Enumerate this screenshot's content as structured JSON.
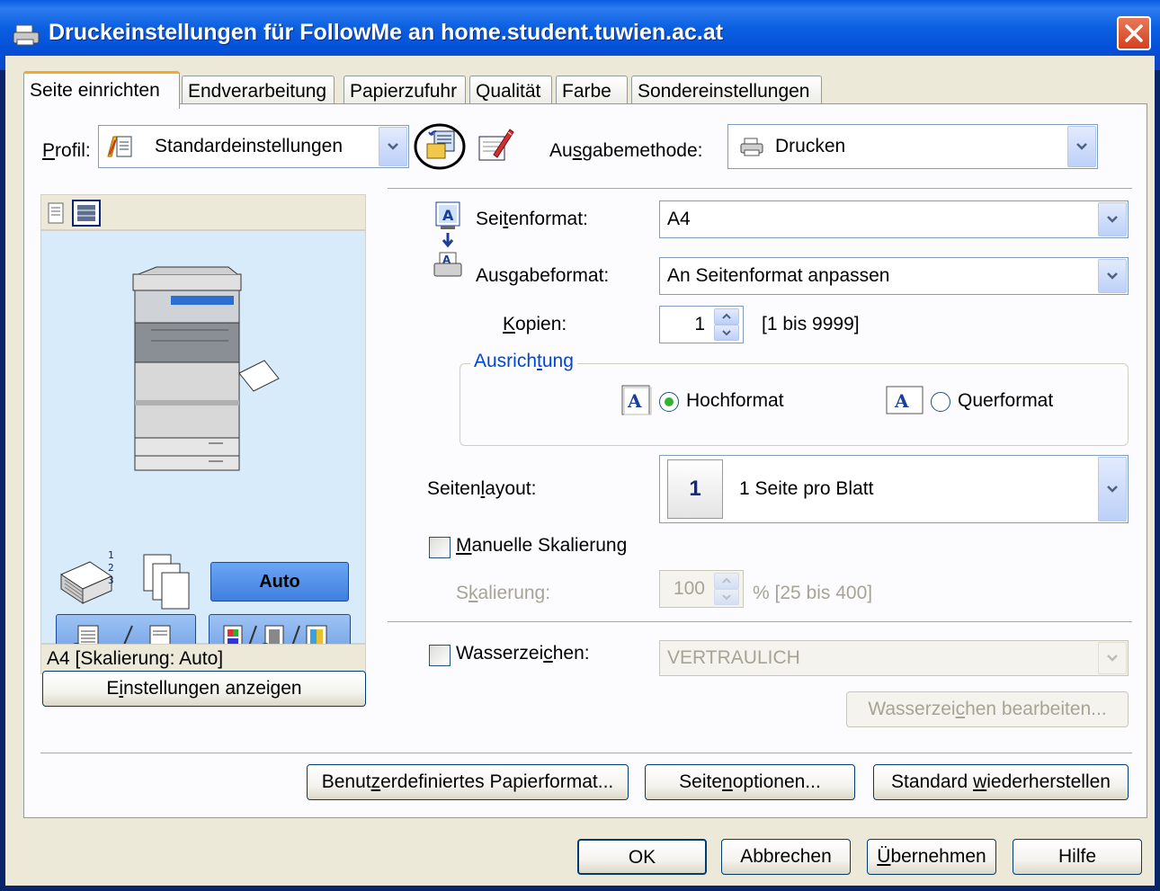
{
  "window": {
    "title": "Druckeinstellungen für FollowMe an home.student.tuwien.ac.at"
  },
  "tabs": [
    {
      "label": "Seite einrichten",
      "active": true
    },
    {
      "label": "Endverarbeitung"
    },
    {
      "label": "Papierzufuhr"
    },
    {
      "label": "Qualität"
    },
    {
      "label": "Farbe"
    },
    {
      "label": "Sondereinstellungen"
    }
  ],
  "profile": {
    "label": "Profil:",
    "value": "Standardeinstellungen"
  },
  "output_method": {
    "label": "Ausgabemethode:",
    "value": "Drucken"
  },
  "preview": {
    "auto_label": "Auto",
    "status": "A4 [Skalierung: Auto]",
    "show_settings": "Einstellungen anzeigen"
  },
  "page_format": {
    "label": "Seitenformat:",
    "value": "A4"
  },
  "output_format": {
    "label": "Ausgabeformat:",
    "value": "An Seitenformat anpassen"
  },
  "copies": {
    "label": "Kopien:",
    "value": "1",
    "range": "[1 bis 9999]"
  },
  "orientation": {
    "group": "Ausrichtung",
    "portrait": "Hochformat",
    "landscape": "Querformat",
    "selected": "Hochformat"
  },
  "page_layout": {
    "label": "Seitenlayout:",
    "number": "1",
    "value": "1 Seite pro Blatt"
  },
  "manual_scaling": {
    "label": "Manuelle Skalierung",
    "checked": false
  },
  "scaling": {
    "label": "Skalierung:",
    "value": "100",
    "range": "% [25 bis 400]"
  },
  "watermark": {
    "label": "Wasserzeichen:",
    "checked": false,
    "value": "VERTRAULICH",
    "edit": "Wasserzeichen bearbeiten..."
  },
  "bottom_buttons": {
    "custom_paper": "Benutzerdefiniertes Papierformat...",
    "page_options": "Seitenoptionen...",
    "restore": "Standard wiederherstellen"
  },
  "dialog_buttons": {
    "ok": "OK",
    "cancel": "Abbrechen",
    "apply": "Übernehmen",
    "help": "Hilfe"
  },
  "colors": {
    "title_blue": "#0a5ce0",
    "panel": "#ece9d8",
    "preview_bg": "#d7ebfb",
    "auto_blue": "#4a8fea"
  }
}
